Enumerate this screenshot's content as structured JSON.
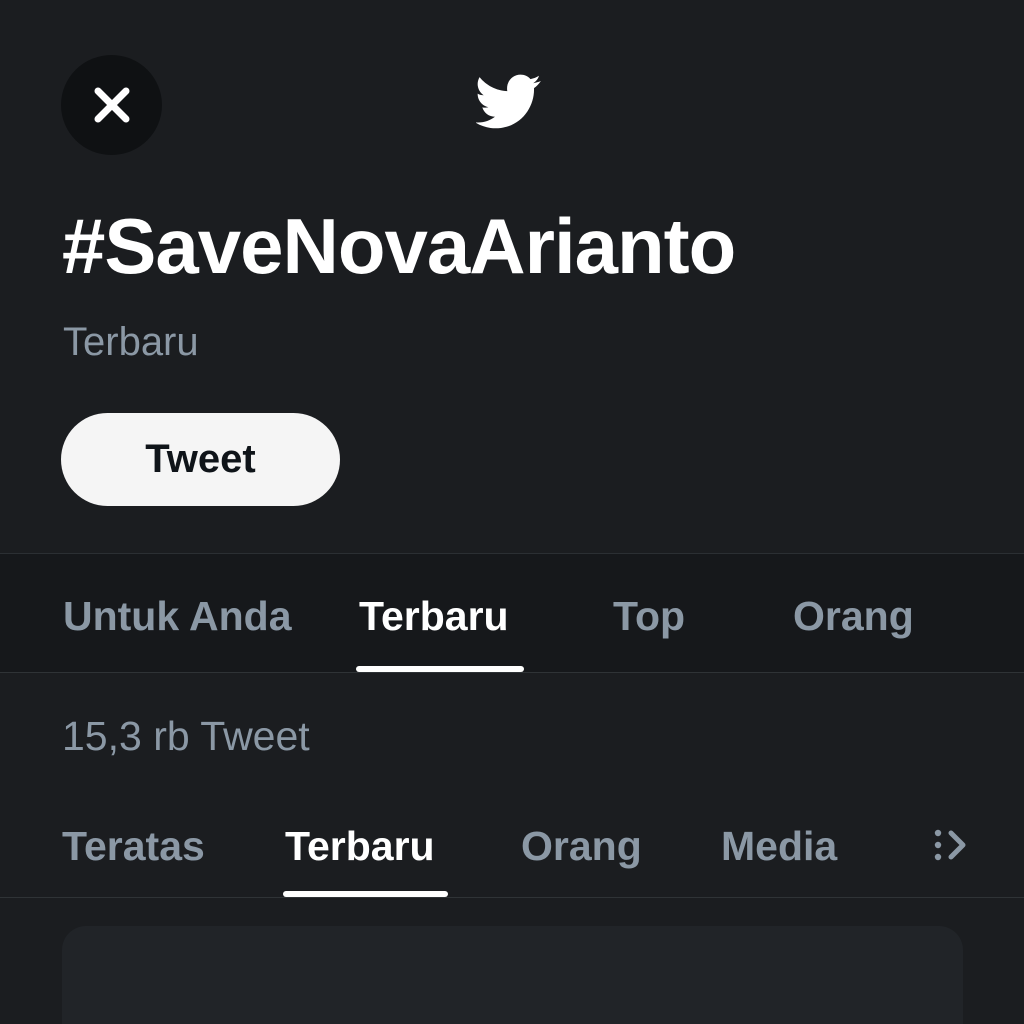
{
  "header": {
    "close_icon": "close-icon",
    "logo_icon": "twitter-bird-icon",
    "hashtag": "#SaveNovaArianto",
    "subtitle": "Terbaru",
    "tweet_button": "Tweet"
  },
  "primary_tabs": [
    {
      "label": "Untuk Anda",
      "active": false
    },
    {
      "label": "Terbaru",
      "active": true
    },
    {
      "label": "Top",
      "active": false
    },
    {
      "label": "Orang",
      "active": false
    }
  ],
  "tweet_count": "15,3 rb Tweet",
  "secondary_tabs": [
    {
      "label": "Teratas",
      "active": false
    },
    {
      "label": "Terbaru",
      "active": true
    },
    {
      "label": "Orang",
      "active": false
    },
    {
      "label": "Media",
      "active": false
    }
  ],
  "more_icon": "more-tabs-icon",
  "colors": {
    "background": "#1b1d20",
    "muted_text": "#8b98a5",
    "active_text": "#ffffff",
    "button_bg": "#f5f5f5"
  }
}
